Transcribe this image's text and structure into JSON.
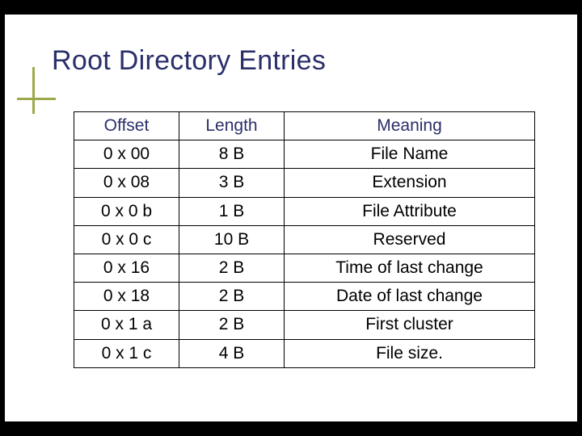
{
  "title": "Root Directory Entries",
  "table": {
    "headers": [
      "Offset",
      "Length",
      "Meaning"
    ],
    "rows": [
      {
        "offset": "0 x 00",
        "length": "8 B",
        "meaning": "File Name"
      },
      {
        "offset": "0 x 08",
        "length": "3 B",
        "meaning": "Extension"
      },
      {
        "offset": "0 x 0 b",
        "length": "1 B",
        "meaning": "File Attribute"
      },
      {
        "offset": "0 x 0 c",
        "length": "10 B",
        "meaning": "Reserved"
      },
      {
        "offset": "0 x 16",
        "length": "2 B",
        "meaning": "Time of last change"
      },
      {
        "offset": "0 x 18",
        "length": "2 B",
        "meaning": "Date of last change"
      },
      {
        "offset": "0 x 1 a",
        "length": "2 B",
        "meaning": "First cluster"
      },
      {
        "offset": "0 x 1 c",
        "length": "4 B",
        "meaning": "File size."
      }
    ]
  },
  "chart_data": {
    "type": "table",
    "columns": [
      "Offset",
      "Length",
      "Meaning"
    ],
    "rows": [
      [
        "0x00",
        "8 B",
        "File Name"
      ],
      [
        "0x08",
        "3 B",
        "Extension"
      ],
      [
        "0x0b",
        "1 B",
        "File Attribute"
      ],
      [
        "0x0c",
        "10 B",
        "Reserved"
      ],
      [
        "0x16",
        "2 B",
        "Time of last change"
      ],
      [
        "0x18",
        "2 B",
        "Date of last change"
      ],
      [
        "0x1a",
        "2 B",
        "First cluster"
      ],
      [
        "0x1c",
        "4 B",
        "File size."
      ]
    ],
    "title": "Root Directory Entries"
  }
}
